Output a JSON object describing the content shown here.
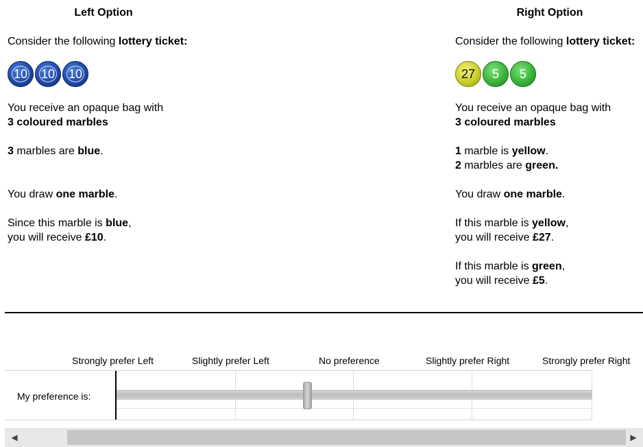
{
  "left": {
    "title": "Left Option",
    "intro_pre": "Consider the following ",
    "intro_bold": "lottery ticket:",
    "balls": [
      "10",
      "10",
      "10"
    ],
    "bag_line1": "You receive an opaque bag with",
    "bag_line2": "3 coloured marbles",
    "marble_count": "3",
    "marble_mid": " marbles are ",
    "marble_color": "blue",
    "marble_end": ".",
    "draw_pre": "You draw ",
    "draw_bold": "one marble",
    "draw_end": ".",
    "since_pre": "Since this marble is ",
    "since_bold": "blue",
    "since_end": ",",
    "receive_pre": "you will receive ",
    "receive_bold": "£10",
    "receive_end": "."
  },
  "right": {
    "title": "Right Option",
    "intro_pre": "Consider the following ",
    "intro_bold": "lottery ticket:",
    "balls": [
      {
        "label": "27",
        "color": "yellow"
      },
      {
        "label": "5",
        "color": "green"
      },
      {
        "label": "5",
        "color": "green"
      }
    ],
    "bag_line1": "You receive an opaque bag with",
    "bag_line2": "3 coloured marbles",
    "m1_count": "1",
    "m1_mid": " marble is ",
    "m1_color": "yellow",
    "m1_end": ".",
    "m2_count": "2",
    "m2_mid": " marbles are ",
    "m2_color": "green.",
    "draw_pre": "You draw ",
    "draw_bold": "one marble",
    "draw_end": ".",
    "if1_pre": "If this marble is ",
    "if1_bold": "yellow",
    "if1_end": ",",
    "rec1_pre": "you will receive ",
    "rec1_bold": "£27",
    "rec1_end": ".",
    "if2_pre": "If this marble is ",
    "if2_bold": "green",
    "if2_end": ",",
    "rec2_pre": "you will receive ",
    "rec2_bold": "£5",
    "rec2_end": "."
  },
  "scale": {
    "labels": [
      "Strongly prefer Left",
      "Slightly prefer Left",
      "No preference",
      "Slightly prefer Right",
      "Strongly prefer Right"
    ],
    "row_label": "My preference is:",
    "slider_value": 0.4
  },
  "scrollbar": {
    "left_arrow": "◀",
    "right_arrow": "▶"
  },
  "colors": {
    "blue_ball": "#1f4aa8",
    "yellow_ball": "#c9cf2a",
    "green_ball": "#3ab43a"
  }
}
